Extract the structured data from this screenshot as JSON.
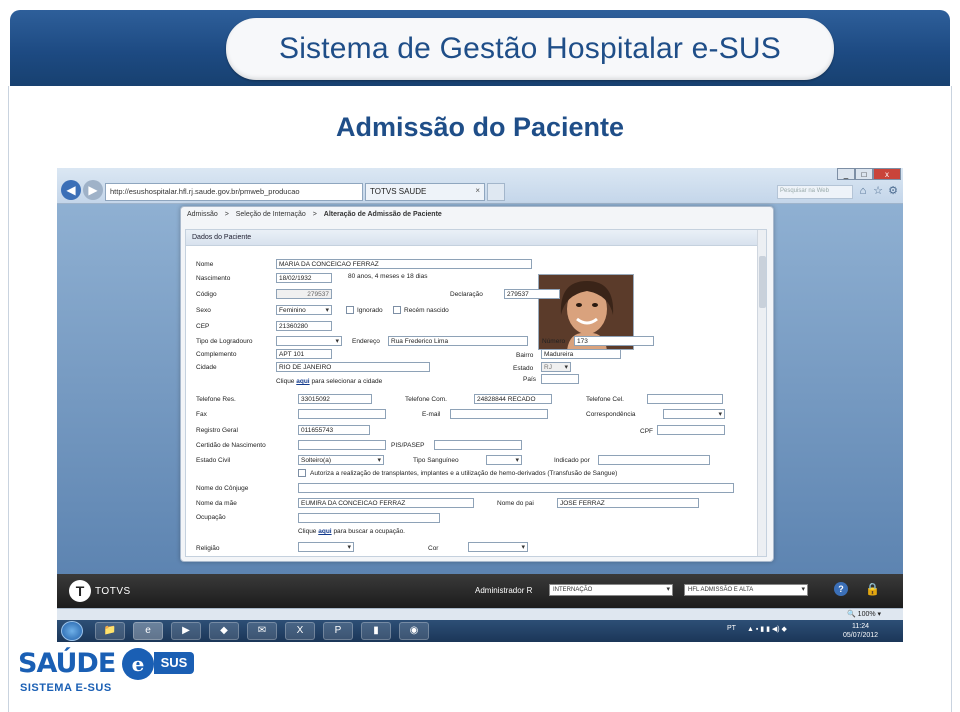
{
  "slide": {
    "title": "Sistema de Gestão Hospitalar e-SUS",
    "subtitle": "Admissão do Paciente"
  },
  "browser": {
    "address": "http://esushospitalar.hfl.rj.saude.gov.br/pmweb_producao",
    "tab_title": "TOTVS SAUDE",
    "search_placeholder": "Pesquisar na Web",
    "zoom": "100%",
    "window_buttons": [
      "_",
      "□",
      "x"
    ]
  },
  "breadcrumb": [
    "Admissão",
    ">",
    "Seleção de Internação",
    ">"
  ],
  "breadcrumb_current": "Alteração de Admissão de Paciente",
  "form": {
    "section_title": "Dados do Paciente",
    "labels": {
      "nome": "Nome",
      "nascimento": "Nascimento",
      "codigo": "Código",
      "declaracao": "Declaração",
      "sexo": "Sexo",
      "ignorado": "Ignorado",
      "recem_nascido": "Recém nascido",
      "cep": "CEP",
      "tipo_logradouro": "Tipo de Logradouro",
      "endereco": "Endereço",
      "numero": "Número",
      "complemento": "Complemento",
      "bairro": "Bairro",
      "cidade": "Cidade",
      "estado": "Estado",
      "pais": "País",
      "telefone_res": "Telefone Res.",
      "telefone_com": "Telefone Com.",
      "telefone_cel": "Telefone Cel.",
      "fax": "Fax",
      "email": "E-mail",
      "correspondencia": "Correspondência",
      "registro_geral": "Registro Geral",
      "cpf": "CPF",
      "certidao": "Certidão de Nascimento",
      "pis": "PIS/PASEP",
      "estado_civil": "Estado Civil",
      "tipo_sanguineo": "Tipo Sanguíneo",
      "indicado_por": "Indicado por",
      "autoriza": "Autoriza a realização de transplantes, implantes e a utilização de hemo-derivados (Transfusão de Sangue)",
      "conjuge": "Nome do Cônjuge",
      "mae": "Nome da mãe",
      "pai": "Nome do pai",
      "ocupacao": "Ocupação",
      "religiao": "Religião",
      "cor": "Cor"
    },
    "values": {
      "nome": "MARIA DA CONCEICAO FERRAZ",
      "nascimento": "18/02/1932",
      "idade": "80 anos, 4 meses e 18 dias",
      "codigo": "279537",
      "declaracao": "279537",
      "sexo": "Feminino",
      "cep": "21360280",
      "endereco": "Rua Frederico Lima",
      "numero": "173",
      "complemento": "APT 101",
      "bairro": "Madureira",
      "cidade": "RIO DE JANEIRO",
      "estado": "RJ",
      "telefone_res": "33015092",
      "telefone_com": "24828844 RECADO",
      "registro_geral": "011655743",
      "estado_civil": "Solteiro(a)",
      "mae": "EUMIRA DA CONCEICAO FERRAZ",
      "pai": "JOSE FERRAZ"
    },
    "cidade_hint": {
      "pre": "Clique",
      "link": "aqui",
      "post": "para selecionar a cidade"
    },
    "ocupacao_hint": {
      "pre": "Clique",
      "link": "aqui",
      "post": "para buscar a ocupação."
    }
  },
  "app_toolbar": {
    "brand": "TOTVS",
    "user": "Administrador R",
    "setor": "INTERNAÇÃO",
    "unidade": "HFL ADMISSÃO E ALTA"
  },
  "taskbar": {
    "lang": "PT",
    "time": "11:24",
    "date": "05/07/2012"
  },
  "logo": {
    "main": "SAÚDE",
    "e": "e",
    "sus": "SUS",
    "sub": "SISTEMA E-SUS"
  }
}
